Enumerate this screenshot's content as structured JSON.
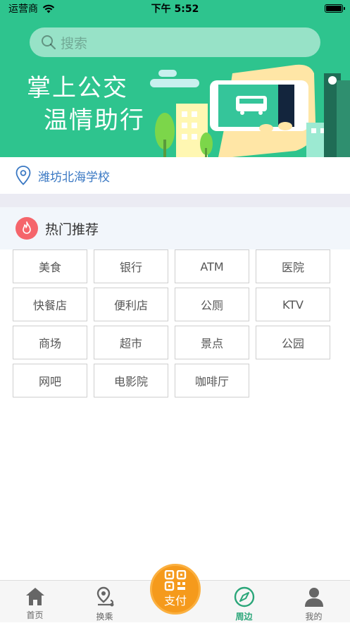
{
  "status": {
    "carrier": "运营商",
    "time": "下午 5:52"
  },
  "search": {
    "placeholder": "搜索"
  },
  "banner": {
    "slogan_line1": "掌上公交",
    "slogan_line2": "温情助行"
  },
  "location": {
    "name": "潍坊北海学校"
  },
  "hot": {
    "title": "热门推荐",
    "items": [
      "美食",
      "银行",
      "ATM",
      "医院",
      "快餐店",
      "便利店",
      "公厕",
      "KTV",
      "商场",
      "超市",
      "景点",
      "公园",
      "网吧",
      "电影院",
      "咖啡厅"
    ]
  },
  "tabbar": {
    "home": "首页",
    "transfer": "换乘",
    "pay": "支付",
    "nearby": "周边",
    "mine": "我的"
  },
  "colors": {
    "brand": "#2ec48e",
    "accent_link": "#3a78c3",
    "pay": "#f59a1c",
    "hot_badge": "#f5656b",
    "active_tab": "#2aa679"
  }
}
